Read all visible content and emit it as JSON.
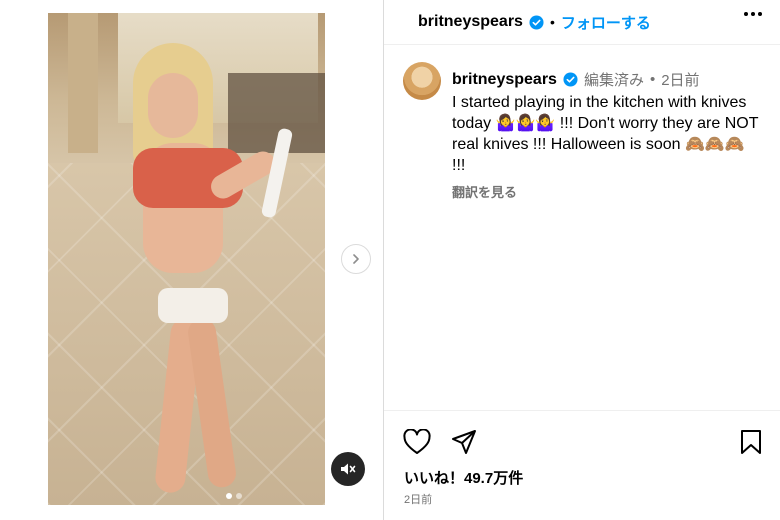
{
  "header": {
    "username": "britneyspears",
    "separator": "•",
    "follow_label": "フォローする"
  },
  "caption": {
    "username": "britneyspears",
    "edited_label": "編集済み",
    "separator": "•",
    "time": "2日前",
    "text": "I started playing in the kitchen with knives today 🤷‍♀️🤷‍♀️🤷‍♀️ !!! Don't worry they are NOT real knives !!! Halloween is soon 🙈🙈🙈 !!!",
    "translate_label": "翻訳を見る"
  },
  "actions": {
    "likes": "いいね！49.7万件",
    "posted_time": "2日前"
  },
  "carousel": {
    "dots": 2,
    "active_index": 0
  },
  "icons": {
    "verified": "verified-badge-icon",
    "like": "heart-icon",
    "share": "paper-plane-icon",
    "save": "bookmark-icon",
    "mute": "speaker-muted-icon",
    "next": "chevron-right-icon",
    "more": "more-options-icon"
  },
  "colors": {
    "accent": "#0095f6",
    "muted_text": "#737373",
    "divider": "#dbdbdb"
  }
}
